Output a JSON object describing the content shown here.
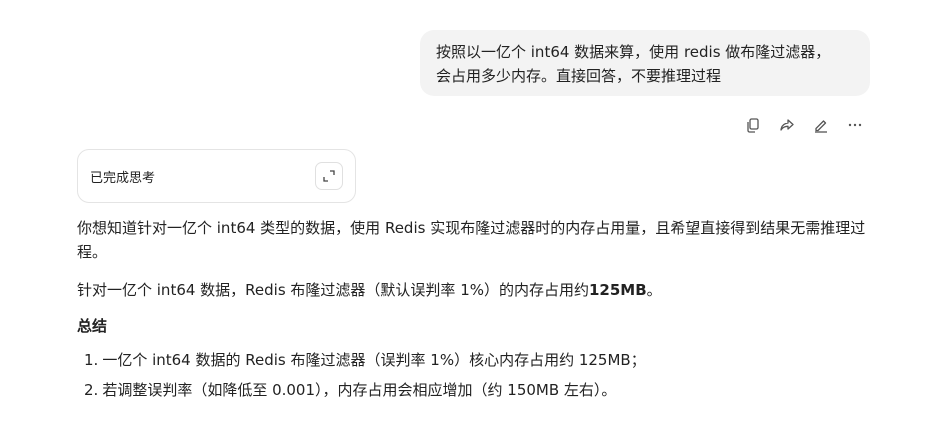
{
  "user_message": {
    "line1": "按照以一亿个 int64 数据来算，使用 redis 做布隆过滤器，",
    "line2": "会占用多少内存。直接回答，不要推理过程"
  },
  "actions": [
    {
      "icon": "copy-icon"
    },
    {
      "icon": "share-icon"
    },
    {
      "icon": "edit-icon"
    },
    {
      "icon": "more-icon"
    }
  ],
  "thinking": {
    "label": "已完成思考",
    "expand_icon": "expand-icon"
  },
  "answer": {
    "paragraph1": "你想知道针对一亿个 int64 类型的数据，使用 Redis 实现布隆过滤器时的内存占用量，且希望直接得到结果无需推理过程。",
    "paragraph2_prefix": "针对一亿个 int64 数据，Redis 布隆过滤器（默认误判率 1%）的内存占用约",
    "paragraph2_bold": "125MB",
    "paragraph2_suffix": "。",
    "summary_title": "总结",
    "items": [
      {
        "num": "1.",
        "text": "一亿个 int64 数据的 Redis 布隆过滤器（误判率 1%）核心内存占用约 125MB；"
      },
      {
        "num": "2.",
        "text": "若调整误判率（如降低至 0.001），内存占用会相应增加（约 150MB 左右）。"
      }
    ]
  }
}
